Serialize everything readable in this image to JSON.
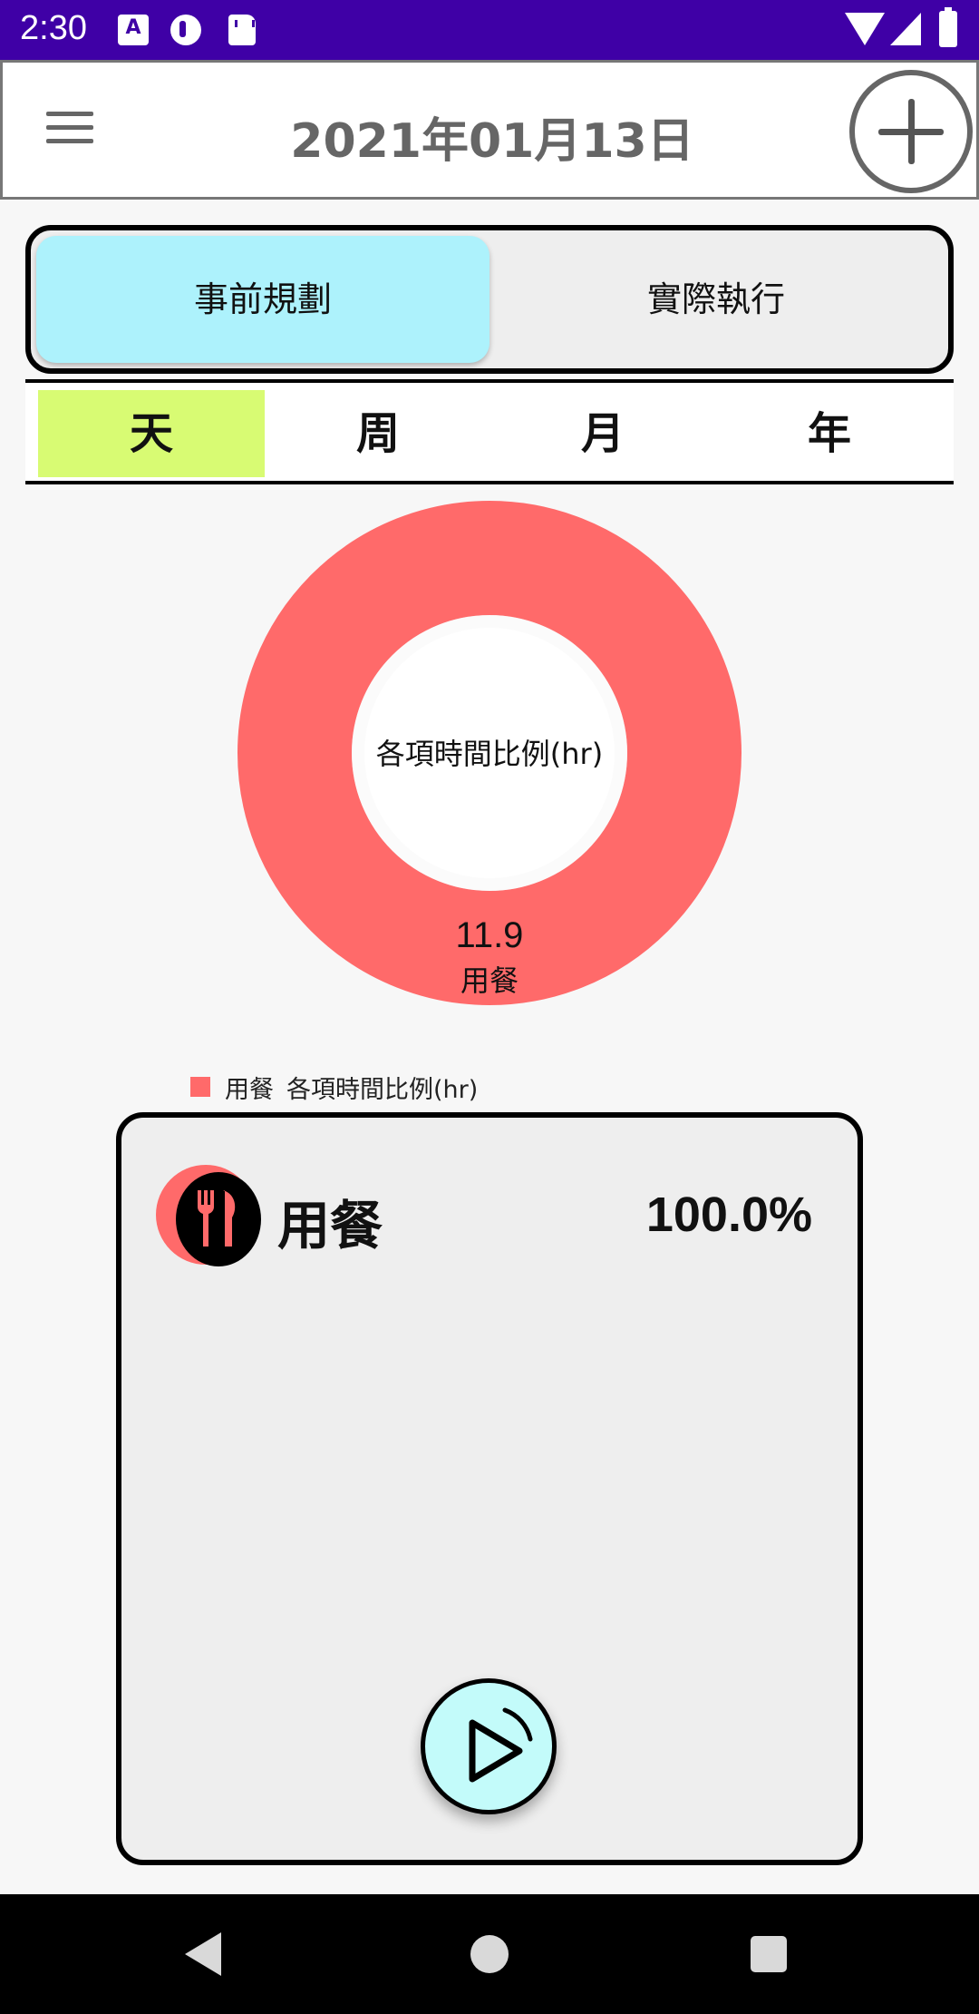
{
  "status_bar": {
    "time": "2:30",
    "notification_badge": "A",
    "icons": [
      "font-app-icon",
      "app-badge-icon",
      "sd-card-icon",
      "wifi-icon",
      "signal-icon",
      "battery-icon"
    ]
  },
  "app_bar": {
    "title": "2021年01月13日",
    "menu_icon": "menu-icon",
    "add_icon": "add-circle-icon"
  },
  "mode_toggle": {
    "options": [
      "事前規劃",
      "實際執行"
    ],
    "selected": "事前規劃"
  },
  "period_tabs": {
    "options": [
      "天",
      "周",
      "月",
      "年"
    ],
    "selected": "天"
  },
  "chart_data": {
    "type": "pie",
    "hole": true,
    "center_label": "各項時間比例(hr)",
    "categories": [
      "用餐"
    ],
    "values": [
      11.9
    ],
    "series": [
      {
        "name": "各項時間比例(hr)",
        "values": [
          11.9
        ]
      }
    ],
    "legend": {
      "position": "bottom-left",
      "entries": [
        "用餐",
        "各項時間比例(hr)"
      ]
    },
    "colors": [
      "#ff6a6a"
    ]
  },
  "activity_card": {
    "name": "用餐",
    "percent": "100.0%",
    "icon": "fork-knife-icon",
    "play_icon": "play-icon"
  },
  "nav_bar": {
    "icons": [
      "back-icon",
      "home-icon",
      "recents-icon"
    ]
  },
  "colors": {
    "status_bar": "#3f00a6",
    "toggle_active": "#adf2fc",
    "tab_selected": "#d8fb73",
    "slice": "#ff6a6a",
    "play_button": "#c3fbfa"
  }
}
